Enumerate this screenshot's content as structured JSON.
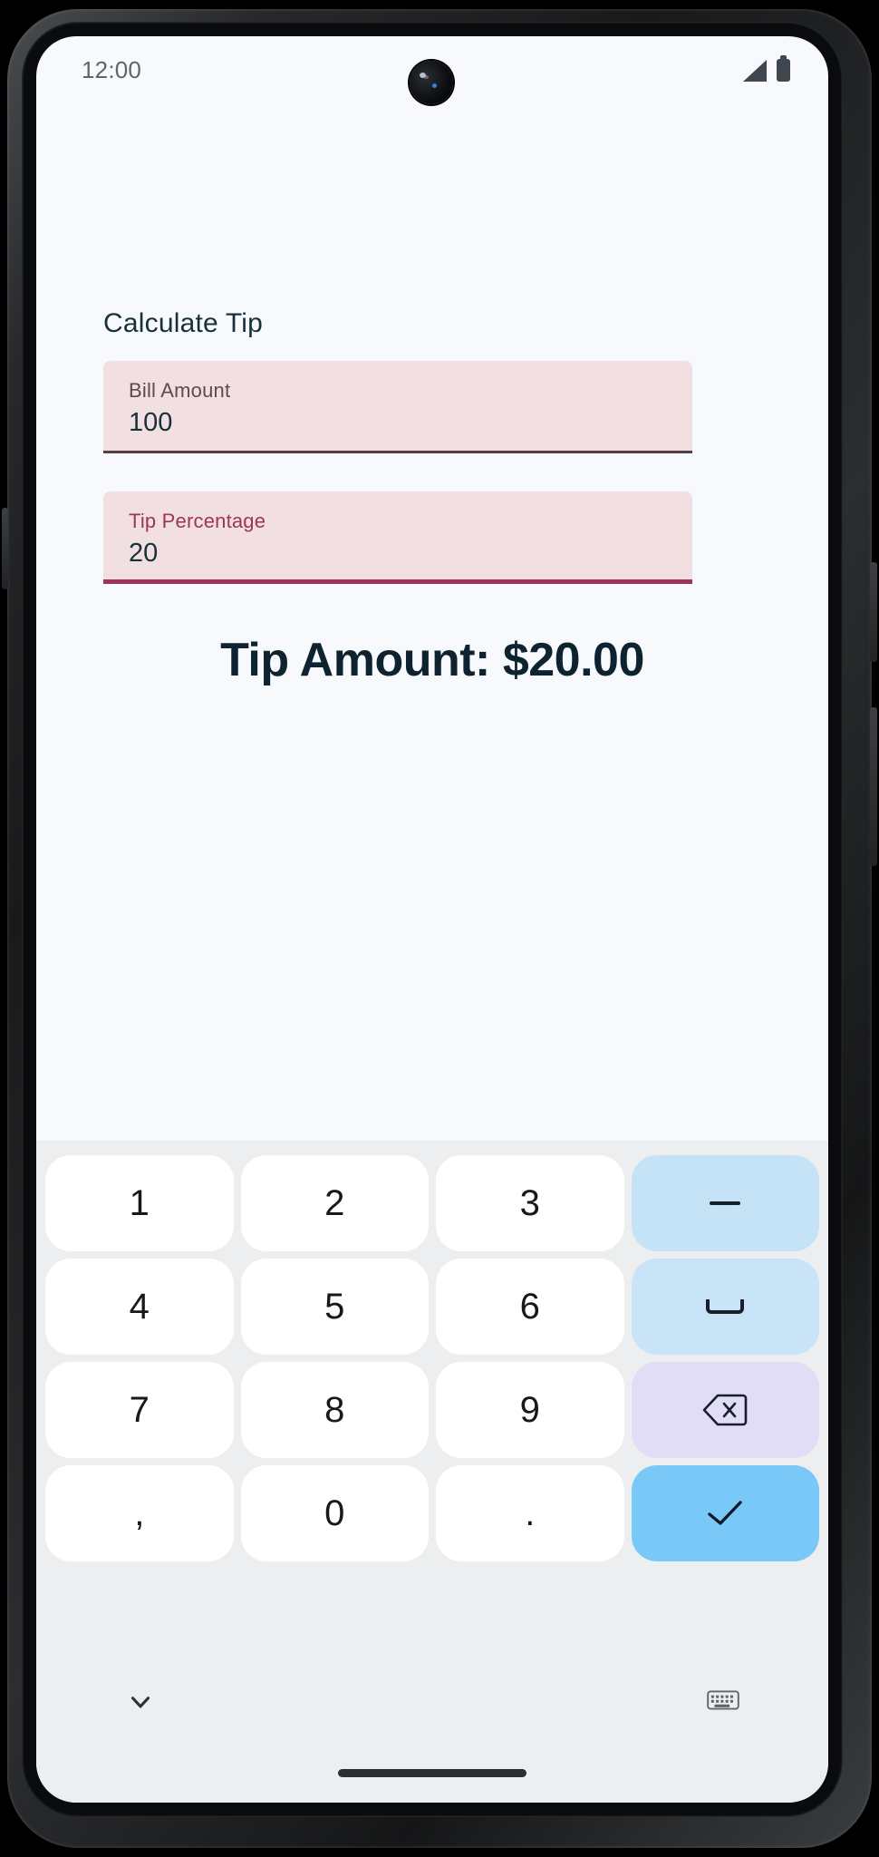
{
  "statusbar": {
    "time": "12:00",
    "signal_icon": "signal-bars-icon",
    "battery_icon": "battery-full-icon",
    "camera_icon": "front-camera-punch-hole"
  },
  "app": {
    "title": "Calculate Tip",
    "fields": [
      {
        "label": "Bill Amount",
        "value": "100",
        "focused": false
      },
      {
        "label": "Tip Percentage",
        "value": "20",
        "focused": true
      }
    ],
    "result": "Tip Amount: $20.00"
  },
  "keyboard": {
    "keys": [
      {
        "label": "1",
        "name": "key-1",
        "type": "digit"
      },
      {
        "label": "2",
        "name": "key-2",
        "type": "digit"
      },
      {
        "label": "3",
        "name": "key-3",
        "type": "digit"
      },
      {
        "label": "−",
        "name": "key-minus",
        "type": "minus"
      },
      {
        "label": "4",
        "name": "key-4",
        "type": "digit"
      },
      {
        "label": "5",
        "name": "key-5",
        "type": "digit"
      },
      {
        "label": "6",
        "name": "key-6",
        "type": "digit"
      },
      {
        "label": "",
        "name": "key-space",
        "type": "space"
      },
      {
        "label": "7",
        "name": "key-7",
        "type": "digit"
      },
      {
        "label": "8",
        "name": "key-8",
        "type": "digit"
      },
      {
        "label": "9",
        "name": "key-9",
        "type": "digit"
      },
      {
        "label": "",
        "name": "key-backspace",
        "type": "backspace"
      },
      {
        "label": ",",
        "name": "key-comma",
        "type": "comma"
      },
      {
        "label": "0",
        "name": "key-0",
        "type": "digit"
      },
      {
        "label": ".",
        "name": "key-period",
        "type": "dot"
      },
      {
        "label": "",
        "name": "key-enter",
        "type": "enter"
      }
    ],
    "bottom_bar": {
      "hide_keyboard_icon": "chevron-down-icon",
      "switch_keyboard_icon": "keyboard-icon"
    }
  },
  "colors": {
    "screen_bg": "#f8f9fd",
    "field_bg": "#f2dfe2",
    "field_focus_accent": "#9d3557",
    "field_unfocus_accent": "#524043",
    "text_dark": "#18303a",
    "keyboard_bg": "#eceef0",
    "key_bg": "#ffffff",
    "key_minus_bg": "#c5e3f6",
    "key_space_bg": "#c8e4f6",
    "key_backspace_bg": "#e2ddf6",
    "key_enter_bg": "#79c8f8"
  }
}
